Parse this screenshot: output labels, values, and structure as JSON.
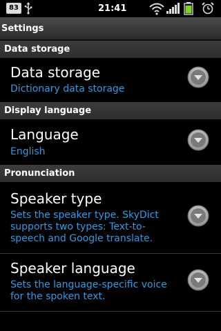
{
  "status_bar": {
    "battery_level": "83",
    "time": "21:41"
  },
  "title": "Settings",
  "categories": [
    {
      "label": "Data storage"
    },
    {
      "label": "Display language"
    },
    {
      "label": "Pronunciation"
    }
  ],
  "preferences": [
    {
      "title": "Data storage",
      "summary": "Dictionary data storage"
    },
    {
      "title": "Language",
      "summary": "English"
    },
    {
      "title": "Speaker type",
      "summary": "Sets the speaker type. SkyDict supports two types: Text-to-speech and Google translate."
    },
    {
      "title": "Speaker language",
      "summary": "Sets the language-specific voice for the spoken text."
    }
  ],
  "icons": {
    "expand": "chevron-down-circle-icon",
    "usb": "usb-icon",
    "wifi": "wifi-icon",
    "signal": "signal-icon",
    "battery": "battery-icon",
    "alarm": "alarm-clock-icon"
  },
  "colors": {
    "summary_text": "#2f9ae0",
    "background": "#000000"
  }
}
